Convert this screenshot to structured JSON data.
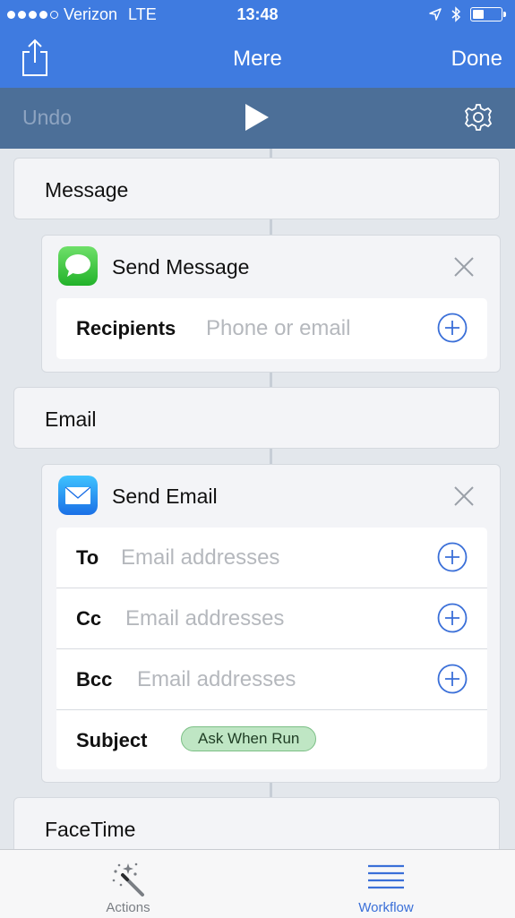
{
  "status_bar": {
    "carrier": "Verizon",
    "network": "LTE",
    "time": "13:48"
  },
  "navbar": {
    "title": "Mere",
    "done_label": "Done"
  },
  "toolbar": {
    "undo_label": "Undo"
  },
  "categories": {
    "message": "Message",
    "email": "Email",
    "facetime": "FaceTime"
  },
  "send_message": {
    "title": "Send Message",
    "recipients_label": "Recipients",
    "recipients_placeholder": "Phone or email"
  },
  "send_email": {
    "title": "Send Email",
    "to_label": "To",
    "to_placeholder": "Email addresses",
    "cc_label": "Cc",
    "cc_placeholder": "Email addresses",
    "bcc_label": "Bcc",
    "bcc_placeholder": "Email addresses",
    "subject_label": "Subject",
    "subject_value": "Ask When Run"
  },
  "tabbar": {
    "actions_label": "Actions",
    "workflow_label": "Workflow"
  },
  "colors": {
    "accent": "#3f7be0",
    "toolbar": "#4c6f98",
    "plus_blue": "#3a6fd8",
    "pill_green": "#bfe6c4"
  }
}
